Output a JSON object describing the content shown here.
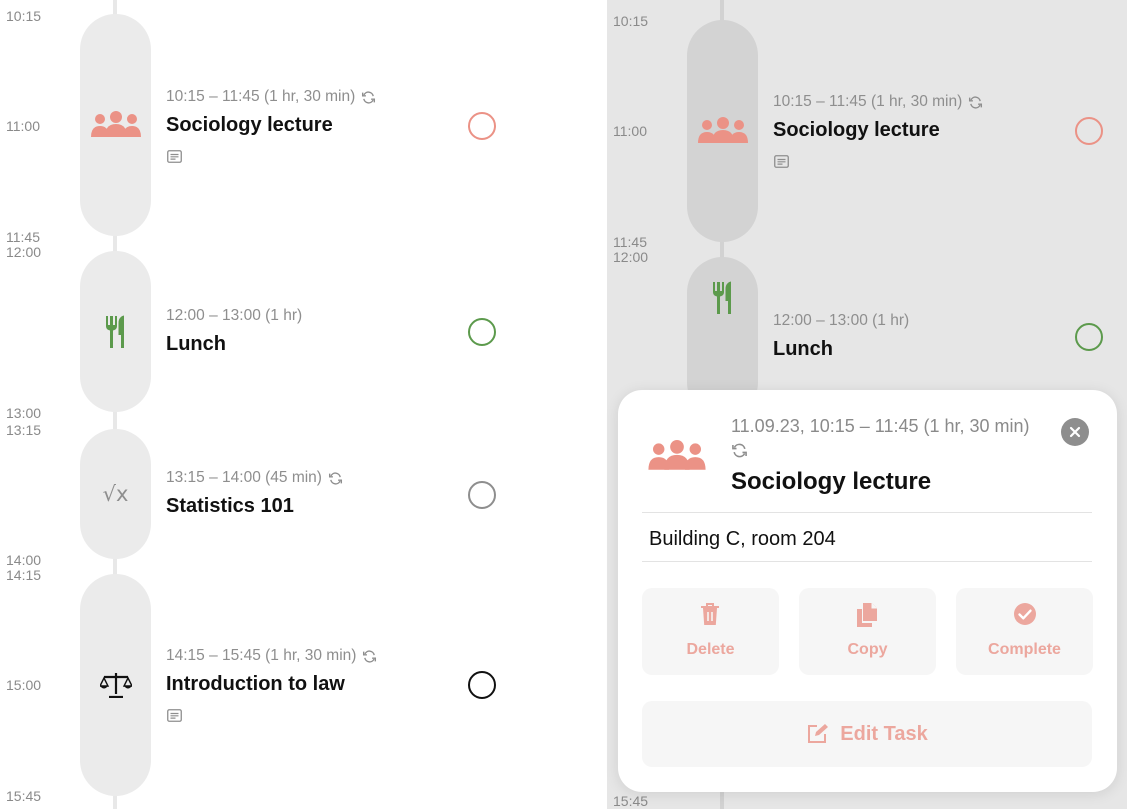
{
  "colors": {
    "accent": "#eb9286",
    "lunch_green": "#5c9a4c",
    "stats_gray": "#8e8e8e",
    "law_black": "#111111",
    "button_text": "#eca79e"
  },
  "timeline": {
    "times": {
      "t1015": "10:15",
      "t1100": "11:00",
      "t1145": "11:45",
      "t1200": "12:00",
      "t1300": "13:00",
      "t1315": "13:15",
      "t1400": "14:00",
      "t1415": "14:15",
      "t1500": "15:00",
      "t1545": "15:45"
    },
    "events": [
      {
        "meta": "10:15 – 11:45 (1 hr, 30 min)",
        "title": "Sociology lecture",
        "icon": "people-group-icon",
        "repeat": true,
        "has_note": true,
        "check_color": "#eb9286"
      },
      {
        "meta": "12:00 – 13:00 (1 hr)",
        "title": "Lunch",
        "icon": "fork-knife-icon",
        "repeat": false,
        "has_note": false,
        "check_color": "#5c9a4c"
      },
      {
        "meta": "13:15 – 14:00 (45 min)",
        "title": "Statistics 101",
        "icon": "square-root-icon",
        "repeat": true,
        "has_note": false,
        "check_color": "#8e8e8e"
      },
      {
        "meta": "14:15 – 15:45 (1 hr, 30 min)",
        "title": "Introduction to law",
        "icon": "scales-icon",
        "repeat": true,
        "has_note": true,
        "check_color": "#111111"
      }
    ],
    "stats_icon_text": "√x"
  },
  "detail_sheet": {
    "meta": "11.09.23, 10:15 – 11:45 (1 hr, 30 min)",
    "title": "Sociology lecture",
    "note": "Building C, room 204",
    "actions": {
      "delete": "Delete",
      "copy": "Copy",
      "complete": "Complete",
      "edit": "Edit Task"
    }
  }
}
